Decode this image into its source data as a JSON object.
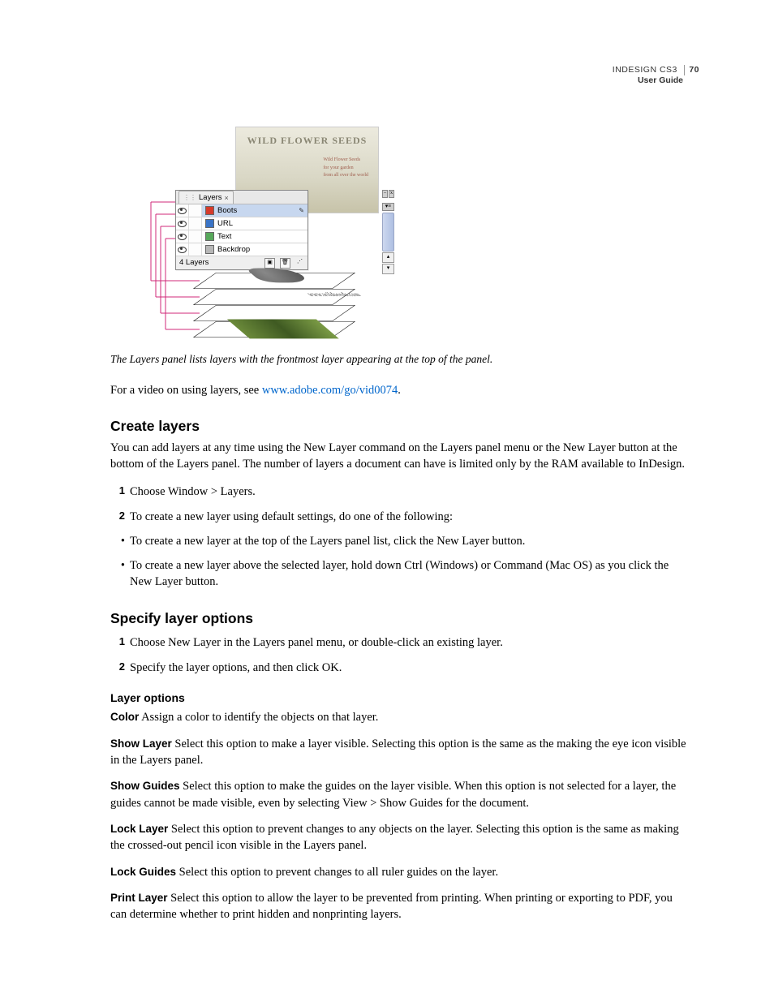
{
  "header": {
    "product": "INDESIGN CS3",
    "guide": "User Guide",
    "page_number": "70"
  },
  "figure": {
    "doc_title": "WILD FLOWER SEEDS",
    "doc_lines": [
      "Wild Flower Seeds",
      "for your garden",
      "from all over the world"
    ],
    "doc_url": "wildseeds.com",
    "panel_tab": "Layers",
    "panel_tab_close": "×",
    "layers": [
      {
        "name": "Boots",
        "color": "#d63a2b"
      },
      {
        "name": "URL",
        "color": "#3a74c6"
      },
      {
        "name": "Text",
        "color": "#57a85b"
      },
      {
        "name": "Backdrop",
        "color": "#b7b7b7"
      }
    ],
    "panel_footer": "4 Layers",
    "plane_url_text": "www.wildseeds.com",
    "caption": "The Layers panel lists layers with the frontmost layer appearing at the top of the panel."
  },
  "intro": {
    "pre": "For a video on using layers, see ",
    "link_text": "www.adobe.com/go/vid0074",
    "post": "."
  },
  "create": {
    "heading": "Create layers",
    "para": "You can add layers at any time using the New Layer command on the Layers panel menu or the New Layer button at the bottom of the Layers panel. The number of layers a document can have is limited only by the RAM available to InDesign.",
    "steps": [
      "Choose Window > Layers.",
      "To create a new layer using default settings, do one of the following:"
    ],
    "bullets": [
      "To create a new layer at the top of the Layers panel list, click the New Layer button.",
      "To create a new layer above the selected layer, hold down Ctrl (Windows) or Command (Mac OS) as you click the New Layer button."
    ]
  },
  "specify": {
    "heading": "Specify layer options",
    "steps": [
      "Choose New Layer in the Layers panel menu, or double-click an existing layer.",
      "Specify the layer options, and then click OK."
    ],
    "subhead": "Layer options",
    "options": [
      {
        "term": "Color",
        "desc": "Assign a color to identify the objects on that layer."
      },
      {
        "term": "Show Layer",
        "desc": "Select this option to make a layer visible. Selecting this option is the same as the making the eye icon visible in the Layers panel."
      },
      {
        "term": "Show Guides",
        "desc": "Select this option to make the guides on the layer visible. When this option is not selected for a layer, the guides cannot be made visible, even by selecting View > Show Guides for the document."
      },
      {
        "term": "Lock Layer",
        "desc": "Select this option to prevent changes to any objects on the layer. Selecting this option is the same as making the crossed-out pencil icon visible in the Layers panel."
      },
      {
        "term": "Lock Guides",
        "desc": "Select this option to prevent changes to all ruler guides on the layer."
      },
      {
        "term": "Print Layer",
        "desc": "Select this option to allow the layer to be prevented from printing. When printing or exporting to PDF, you can determine whether to print hidden and nonprinting layers."
      }
    ]
  }
}
